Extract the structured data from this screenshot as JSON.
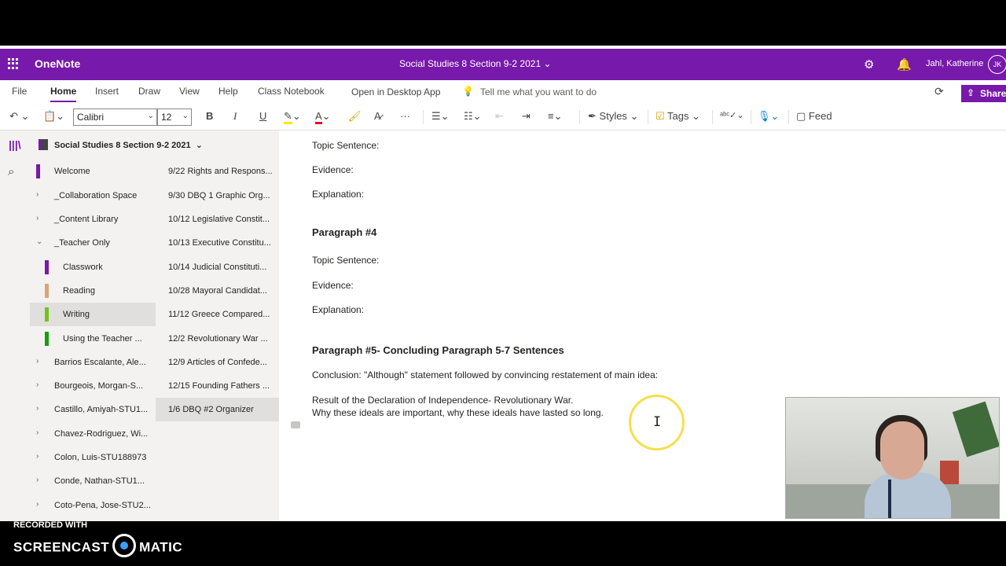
{
  "app": {
    "name": "OneNote",
    "notebook_title": "Social Studies 8 Section 9-2 2021",
    "user_name": "Jahl, Katherine",
    "user_initials": "JK"
  },
  "menu": {
    "file": "File",
    "home": "Home",
    "insert": "Insert",
    "draw": "Draw",
    "view": "View",
    "help": "Help",
    "class_notebook": "Class Notebook",
    "open_desktop": "Open in Desktop App",
    "tell_me": "Tell me what you want to do",
    "share": "Share"
  },
  "toolbar": {
    "font": "Calibri",
    "size": "12",
    "styles": "Styles",
    "tags": "Tags",
    "feed": "Feed"
  },
  "notebook": {
    "name": "Social Studies 8 Section 9-2 2021"
  },
  "sections": [
    {
      "label": "Welcome",
      "color": "#7719aa"
    },
    {
      "label": "_Collaboration Space"
    },
    {
      "label": "_Content Library"
    },
    {
      "label": "_Teacher Only"
    },
    {
      "label": "Classwork",
      "color": "#7719aa"
    },
    {
      "label": "Reading",
      "color": "#d7a57a"
    },
    {
      "label": "Writing",
      "color": "#74c21b"
    },
    {
      "label": "Using the Teacher ...",
      "color": "#13a10e"
    },
    {
      "label": "Barrios Escalante, Ale..."
    },
    {
      "label": "Bourgeois, Morgan-S..."
    },
    {
      "label": "Castillo, Amiyah-STU1..."
    },
    {
      "label": "Chavez-Rodriguez, Wi..."
    },
    {
      "label": "Colon, Luis-STU188973"
    },
    {
      "label": "Conde, Nathan-STU1..."
    },
    {
      "label": "Coto-Pena, Jose-STU2..."
    }
  ],
  "pages": [
    "9/22 Rights and Respons...",
    "9/30 DBQ 1 Graphic Org...",
    "10/12 Legislative Constit...",
    "10/13 Executive Constitu...",
    "10/14 Judicial Constituti...",
    "10/28 Mayoral Candidat...",
    "11/12 Greece Compared...",
    "12/2 Revolutionary War ...",
    "12/9 Articles of Confede...",
    "12/15 Founding Fathers ...",
    "1/6 DBQ #2 Organizer"
  ],
  "content": {
    "topic1": "Topic Sentence:",
    "evidence1": "Evidence:",
    "explanation1": "Explanation:",
    "para4": "Paragraph #4",
    "topic2": "Topic Sentence:",
    "evidence2": "Evidence:",
    "explanation2": "Explanation:",
    "para5": "Paragraph #5- Concluding Paragraph 5-7 Sentences",
    "conclusion": "Conclusion: \"Although\" statement followed by convincing restatement of main idea:",
    "result_line1": "Result of the Declaration of Independence- Revolutionary War.",
    "result_line2": "Why these ideals are important, why these ideals have lasted so long."
  },
  "watermark": {
    "recorded": "RECORDED WITH",
    "brand_left": "SCREENCAST",
    "brand_right": "MATIC"
  }
}
